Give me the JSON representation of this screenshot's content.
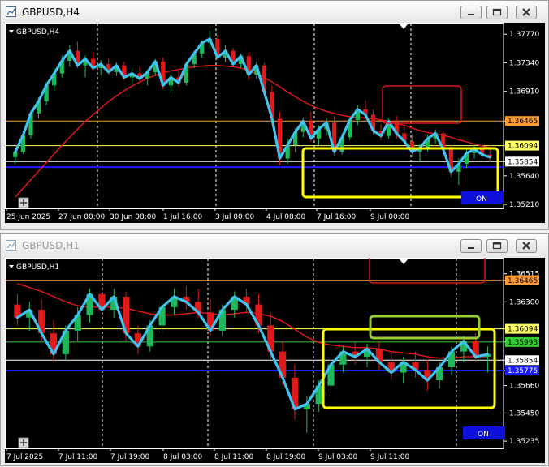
{
  "chart_data": [
    {
      "type": "candlestick",
      "symbol_label": "GBPUSD,H4",
      "window_title": "GBPUSD,H4",
      "y_ticks": [
        "1.37770",
        "1.37340",
        "1.36910",
        "1.36465",
        "1.36094",
        "1.35854",
        "1.35640",
        "1.35210"
      ],
      "x_ticks": [
        "25 Jun 2025",
        "27 Jun 00:00",
        "30 Jun 08:00",
        "1 Jul 16:00",
        "3 Jul 00:00",
        "4 Jul 08:00",
        "7 Jul 16:00",
        "9 Jul 00:00"
      ],
      "ylim": [
        1.3515,
        1.3787
      ],
      "price_lines": [
        {
          "label": "1.36465",
          "value": 1.36465,
          "color": "#ff9933",
          "bg": "#ff9933",
          "fg": "#000000"
        },
        {
          "label": "1.36094",
          "value": 1.36094,
          "color": "#ffff66",
          "bg": "#ffff66",
          "fg": "#000000"
        },
        {
          "label": "1.35854",
          "value": 1.35854,
          "color": "#ffffff",
          "bg": "#ffffff",
          "fg": "#000000"
        }
      ],
      "blue_line": 1.3577,
      "candles": [
        [
          1.3592,
          1.3604,
          1.3582,
          1.36
        ],
        [
          1.36,
          1.3632,
          1.3597,
          1.3625
        ],
        [
          1.3625,
          1.3662,
          1.362,
          1.3658
        ],
        [
          1.3658,
          1.3682,
          1.365,
          1.3676
        ],
        [
          1.3676,
          1.3705,
          1.367,
          1.37
        ],
        [
          1.37,
          1.3726,
          1.3692,
          1.3718
        ],
        [
          1.3718,
          1.3745,
          1.3712,
          1.3737
        ],
        [
          1.3737,
          1.376,
          1.3728,
          1.3752
        ],
        [
          1.3752,
          1.3766,
          1.3726,
          1.373
        ],
        [
          1.373,
          1.3745,
          1.3712,
          1.374
        ],
        [
          1.374,
          1.375,
          1.3722,
          1.3726
        ],
        [
          1.3726,
          1.3738,
          1.3715,
          1.3732
        ],
        [
          1.3732,
          1.374,
          1.3716,
          1.372
        ],
        [
          1.372,
          1.3735,
          1.3714,
          1.373
        ],
        [
          1.373,
          1.3736,
          1.3708,
          1.3712
        ],
        [
          1.3712,
          1.3724,
          1.3702,
          1.3718
        ],
        [
          1.3718,
          1.3728,
          1.3706,
          1.371
        ],
        [
          1.371,
          1.3724,
          1.37,
          1.372
        ],
        [
          1.372,
          1.374,
          1.3715,
          1.3736
        ],
        [
          1.3736,
          1.3742,
          1.3694,
          1.37
        ],
        [
          1.37,
          1.3716,
          1.3688,
          1.3712
        ],
        [
          1.3712,
          1.3722,
          1.3698,
          1.3704
        ],
        [
          1.3704,
          1.3736,
          1.37,
          1.3732
        ],
        [
          1.3732,
          1.3752,
          1.3726,
          1.3748
        ],
        [
          1.3748,
          1.3768,
          1.3742,
          1.3764
        ],
        [
          1.3764,
          1.3782,
          1.3755,
          1.377
        ],
        [
          1.377,
          1.3776,
          1.3738,
          1.3742
        ],
        [
          1.3742,
          1.376,
          1.3735,
          1.3752
        ],
        [
          1.3752,
          1.3756,
          1.3728,
          1.3732
        ],
        [
          1.3732,
          1.3748,
          1.3726,
          1.3744
        ],
        [
          1.3744,
          1.375,
          1.3708,
          1.3716
        ],
        [
          1.3716,
          1.3736,
          1.371,
          1.373
        ],
        [
          1.373,
          1.3734,
          1.3686,
          1.369
        ],
        [
          1.369,
          1.37,
          1.364,
          1.365
        ],
        [
          1.365,
          1.366,
          1.358,
          1.359
        ],
        [
          1.359,
          1.362,
          1.3582,
          1.361
        ],
        [
          1.361,
          1.3636,
          1.36,
          1.363
        ],
        [
          1.363,
          1.3652,
          1.3622,
          1.3646
        ],
        [
          1.3646,
          1.366,
          1.3615,
          1.362
        ],
        [
          1.362,
          1.364,
          1.361,
          1.3634
        ],
        [
          1.3634,
          1.3652,
          1.3625,
          1.3644
        ],
        [
          1.3644,
          1.3654,
          1.3594,
          1.36
        ],
        [
          1.36,
          1.3628,
          1.3596,
          1.3622
        ],
        [
          1.3622,
          1.3652,
          1.3618,
          1.3648
        ],
        [
          1.3648,
          1.367,
          1.364,
          1.3664
        ],
        [
          1.3664,
          1.3678,
          1.365,
          1.3656
        ],
        [
          1.3656,
          1.3664,
          1.3626,
          1.3632
        ],
        [
          1.3632,
          1.3642,
          1.3618,
          1.3624
        ],
        [
          1.3624,
          1.365,
          1.362,
          1.3646
        ],
        [
          1.3646,
          1.3654,
          1.362,
          1.3628
        ],
        [
          1.3628,
          1.364,
          1.361,
          1.3616
        ],
        [
          1.3616,
          1.3626,
          1.3592,
          1.36
        ],
        [
          1.36,
          1.3612,
          1.3584,
          1.3606
        ],
        [
          1.3606,
          1.3626,
          1.36,
          1.362
        ],
        [
          1.362,
          1.3634,
          1.3612,
          1.3628
        ],
        [
          1.3628,
          1.3632,
          1.3596,
          1.3604
        ],
        [
          1.3604,
          1.3612,
          1.3562,
          1.357
        ],
        [
          1.357,
          1.359,
          1.355,
          1.3582
        ],
        [
          1.3582,
          1.3606,
          1.3576,
          1.3598
        ],
        [
          1.3598,
          1.3612,
          1.359,
          1.3604
        ],
        [
          1.3604,
          1.3614,
          1.3592,
          1.3596
        ],
        [
          1.3596,
          1.361,
          1.3585,
          1.3592
        ]
      ],
      "ma": [
        1.3532,
        1.3545,
        1.3558,
        1.3571,
        1.3584,
        1.3597,
        1.361,
        1.3622,
        1.3634,
        1.3646,
        1.3656,
        1.3666,
        1.3676,
        1.3684,
        1.3692,
        1.3699,
        1.3705,
        1.3711,
        1.3715,
        1.3719,
        1.3722,
        1.3724,
        1.3726,
        1.3728,
        1.3729,
        1.373,
        1.373,
        1.3729,
        1.3728,
        1.3726,
        1.3722,
        1.3718,
        1.3712,
        1.3705,
        1.3698,
        1.369,
        1.3683,
        1.3676,
        1.367,
        1.3665,
        1.3661,
        1.3658,
        1.3655,
        1.3653,
        1.3652,
        1.3651,
        1.365,
        1.3648,
        1.3646,
        1.3643,
        1.364,
        1.3636,
        1.3632,
        1.3629,
        1.3627,
        1.3625,
        1.3622,
        1.3618,
        1.3615,
        1.3612,
        1.3609,
        1.3606
      ],
      "on_label": "ON"
    },
    {
      "type": "candlestick",
      "symbol_label": "GBPUSD,H1",
      "window_title": "GBPUSD,H1",
      "y_ticks": [
        "1.36515",
        "1.36465",
        "1.36300",
        "1.36094",
        "1.35993",
        "1.35854",
        "1.35775",
        "1.35660",
        "1.35450",
        "1.35235"
      ],
      "x_ticks": [
        "7 Jul 2025",
        "7 Jul 11:00",
        "7 Jul 19:00",
        "8 Jul 03:00",
        "8 Jul 11:00",
        "8 Jul 19:00",
        "9 Jul 03:00",
        "9 Jul 11:00"
      ],
      "ylim": [
        1.3518,
        1.366
      ],
      "price_lines": [
        {
          "label": "1.36465",
          "value": 1.36465,
          "color": "#ff9933",
          "bg": "#ff9933",
          "fg": "#000000"
        },
        {
          "label": "1.36094",
          "value": 1.36094,
          "color": "#ffff66",
          "bg": "#ffff66",
          "fg": "#000000"
        },
        {
          "label": "1.35993",
          "value": 1.35993,
          "color": "#33cc33",
          "bg": "#33cc33",
          "fg": "#000000"
        },
        {
          "label": "1.35854",
          "value": 1.35854,
          "color": "#ffffff",
          "bg": "#ffffff",
          "fg": "#000000"
        },
        {
          "label": "1.35775",
          "value": 1.35775,
          "color": "#1a1aff",
          "bg": "#1a1aff",
          "fg": "#ffffff"
        }
      ],
      "candles": [
        [
          1.3628,
          1.3636,
          1.3612,
          1.3618
        ],
        [
          1.3618,
          1.363,
          1.3608,
          1.3624
        ],
        [
          1.3624,
          1.3632,
          1.36,
          1.3606
        ],
        [
          1.3606,
          1.3616,
          1.3584,
          1.359
        ],
        [
          1.359,
          1.3612,
          1.3586,
          1.3608
        ],
        [
          1.3608,
          1.3626,
          1.36,
          1.362
        ],
        [
          1.362,
          1.364,
          1.3614,
          1.3636
        ],
        [
          1.3636,
          1.3644,
          1.3618,
          1.3624
        ],
        [
          1.3624,
          1.364,
          1.3618,
          1.3634
        ],
        [
          1.3634,
          1.3638,
          1.36,
          1.3606
        ],
        [
          1.3606,
          1.3612,
          1.359,
          1.3596
        ],
        [
          1.3596,
          1.3616,
          1.3592,
          1.3612
        ],
        [
          1.3612,
          1.363,
          1.3606,
          1.3626
        ],
        [
          1.3626,
          1.364,
          1.362,
          1.3634
        ],
        [
          1.3634,
          1.3642,
          1.3624,
          1.363
        ],
        [
          1.363,
          1.364,
          1.3618,
          1.3622
        ],
        [
          1.3622,
          1.3632,
          1.3604,
          1.3608
        ],
        [
          1.3608,
          1.3628,
          1.3604,
          1.3624
        ],
        [
          1.3624,
          1.3638,
          1.3618,
          1.3634
        ],
        [
          1.3634,
          1.364,
          1.3622,
          1.3628
        ],
        [
          1.3628,
          1.3636,
          1.3606,
          1.3612
        ],
        [
          1.3612,
          1.3622,
          1.3586,
          1.3592
        ],
        [
          1.3592,
          1.36,
          1.3566,
          1.3572
        ],
        [
          1.3572,
          1.3582,
          1.354,
          1.3548
        ],
        [
          1.3548,
          1.3558,
          1.353,
          1.3552
        ],
        [
          1.3552,
          1.357,
          1.3546,
          1.3566
        ],
        [
          1.3566,
          1.3586,
          1.356,
          1.3582
        ],
        [
          1.3582,
          1.3596,
          1.3576,
          1.3592
        ],
        [
          1.3592,
          1.36,
          1.3582,
          1.3588
        ],
        [
          1.3588,
          1.3598,
          1.358,
          1.3594
        ],
        [
          1.3594,
          1.36,
          1.3578,
          1.3584
        ],
        [
          1.3584,
          1.3592,
          1.357,
          1.3576
        ],
        [
          1.3576,
          1.3588,
          1.3568,
          1.3584
        ],
        [
          1.3584,
          1.3592,
          1.3572,
          1.3578
        ],
        [
          1.3578,
          1.3586,
          1.3562,
          1.357
        ],
        [
          1.357,
          1.3584,
          1.3564,
          1.358
        ],
        [
          1.358,
          1.3596,
          1.3574,
          1.3592
        ],
        [
          1.3592,
          1.3604,
          1.3584,
          1.36
        ],
        [
          1.36,
          1.3606,
          1.3584,
          1.3588
        ],
        [
          1.3588,
          1.3596,
          1.3576,
          1.359
        ]
      ],
      "ma": [
        1.3644,
        1.3641,
        1.3638,
        1.3634,
        1.363,
        1.3627,
        1.3626,
        1.3626,
        1.3626,
        1.3625,
        1.3623,
        1.3621,
        1.362,
        1.362,
        1.3621,
        1.3622,
        1.3621,
        1.362,
        1.3621,
        1.3622,
        1.3621,
        1.3619,
        1.3615,
        1.3609,
        1.3603,
        1.3599,
        1.3597,
        1.3596,
        1.3595,
        1.3595,
        1.3594,
        1.3592,
        1.3591,
        1.359,
        1.3588,
        1.3587,
        1.3587,
        1.3588,
        1.3588,
        1.3588
      ],
      "on_label": "ON"
    }
  ]
}
